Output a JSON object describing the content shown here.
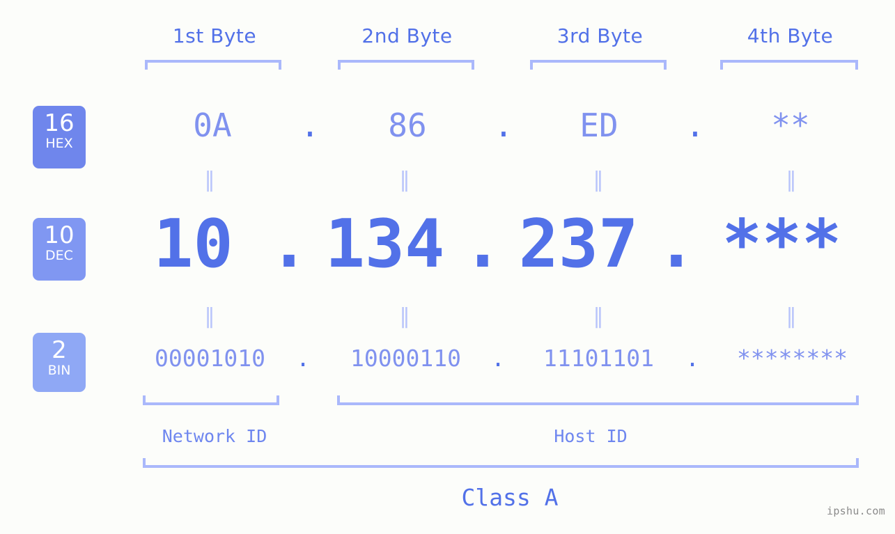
{
  "meta": {
    "watermark": "ipshu.com",
    "background_color": "#fcfdfa",
    "accent_strong": "#5271e8",
    "accent_mid": "#8092ef",
    "accent_light": "#aab8fb"
  },
  "headers": [
    {
      "label": "1st Byte"
    },
    {
      "label": "2nd Byte"
    },
    {
      "label": "3rd Byte"
    },
    {
      "label": "4th Byte"
    }
  ],
  "badges": [
    {
      "base": "16",
      "system": "HEX",
      "color": "#6f86ec"
    },
    {
      "base": "10",
      "system": "DEC",
      "color": "#8097f2"
    },
    {
      "base": "2",
      "system": "BIN",
      "color": "#8fa8f5"
    }
  ],
  "rows": {
    "hex": {
      "base_label": "HEX",
      "values": [
        "0A",
        "86",
        "ED",
        "**"
      ],
      "separator": "."
    },
    "dec": {
      "base_label": "DEC",
      "values": [
        "10",
        "134",
        "237",
        "***"
      ],
      "separator": "."
    },
    "bin": {
      "base_label": "BIN",
      "values": [
        "00001010",
        "10000110",
        "11101101",
        "********"
      ],
      "separator": "."
    }
  },
  "equals_symbol": "‖",
  "sections": [
    {
      "label": "Network ID"
    },
    {
      "label": "Host ID"
    }
  ],
  "class": {
    "label": "Class A"
  }
}
